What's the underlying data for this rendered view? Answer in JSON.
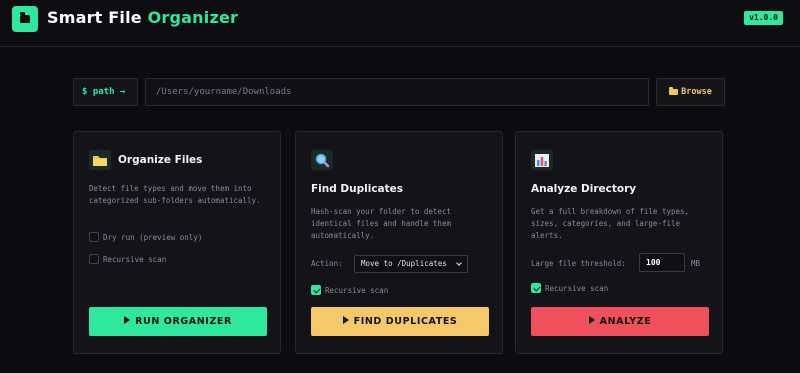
{
  "header": {
    "title_part1": "Smart File ",
    "title_part2": "Organizer",
    "version": "v1.0.0",
    "logo_icon": "folder-icon"
  },
  "path_bar": {
    "label": "$ path →",
    "value": "/Users/yourname/Downloads",
    "browse_label": "Browse",
    "browse_icon": "folder-icon"
  },
  "cards": {
    "organize": {
      "icon": "folder-icon",
      "title": "Organize Files",
      "description": "Detect file types and move them into categorized sub-folders automatically.",
      "options": [
        {
          "label": "Dry run (preview only)",
          "checked": false
        },
        {
          "label": "Recursive scan",
          "checked": false
        }
      ],
      "button": "RUN ORGANIZER",
      "button_color": "#2ee89e"
    },
    "duplicates": {
      "icon": "magnifier-icon",
      "title": "Find Duplicates",
      "description": "Hash-scan your folder to detect identical files and handle them automatically.",
      "action_label": "Action:",
      "action_value": "Move to /Duplicates",
      "options": [
        {
          "label": "Recursive scan",
          "checked": true
        }
      ],
      "button": "FIND DUPLICATES",
      "button_color": "#f5c86a"
    },
    "analyze": {
      "icon": "bar-chart-icon",
      "title": "Analyze Directory",
      "description": "Get a full breakdown of file types, sizes, categories, and large-file alerts.",
      "threshold_label": "Large file threshold:",
      "threshold_value": "100",
      "threshold_unit": "MB",
      "options": [
        {
          "label": "Recursive scan",
          "checked": true
        }
      ],
      "button": "ANALYZE",
      "button_color": "#f0505c"
    }
  }
}
